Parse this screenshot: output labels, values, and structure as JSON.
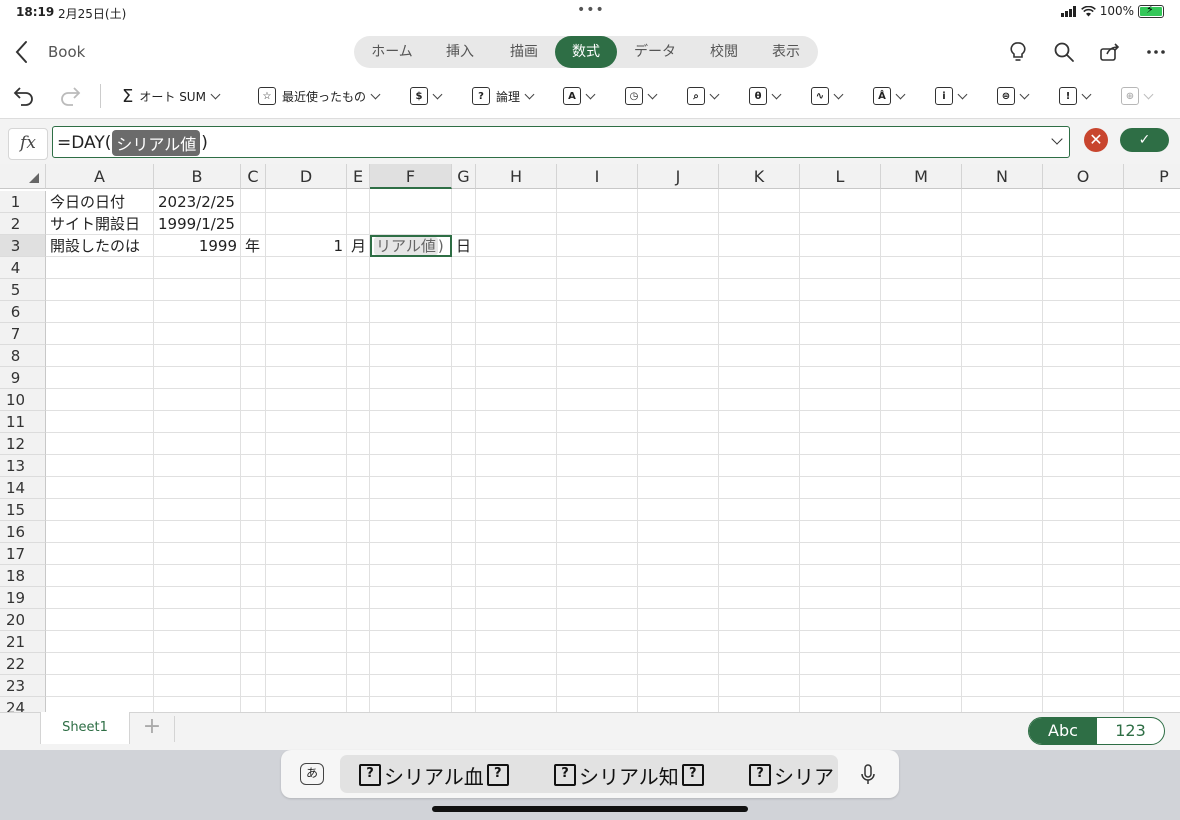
{
  "status": {
    "time": "18:19",
    "date": "2月25日(土)",
    "battery": "100%"
  },
  "header": {
    "book_title": "Book"
  },
  "tabs": [
    {
      "label": "ホーム"
    },
    {
      "label": "挿入"
    },
    {
      "label": "描画"
    },
    {
      "label": "数式"
    },
    {
      "label": "データ"
    },
    {
      "label": "校閲"
    },
    {
      "label": "表示"
    }
  ],
  "active_tab": "数式",
  "ribbon": {
    "autosum_label": "オート SUM",
    "recent_label": "最近使ったもの",
    "logical_label": "論理",
    "autosum_symbol": "Σ"
  },
  "formula": {
    "fx_label": "fx",
    "prefix": "=DAY(",
    "arg_chip": "シリアル値",
    "suffix": ")",
    "cancel_symbol": "✕",
    "enter_symbol": "✓"
  },
  "grid": {
    "columns": [
      "A",
      "B",
      "C",
      "D",
      "E",
      "F",
      "G",
      "H",
      "I",
      "J",
      "K",
      "L",
      "M",
      "N",
      "O",
      "P"
    ],
    "rows": [
      "1",
      "2",
      "3",
      "4",
      "5",
      "6",
      "7",
      "8",
      "9",
      "10",
      "11",
      "12",
      "13",
      "14",
      "15",
      "16",
      "17",
      "18",
      "19",
      "20",
      "21",
      "22",
      "23",
      "24"
    ],
    "cells": {
      "A1": "今日の日付",
      "B1": "2023/2/25",
      "A2": "サイト開設日",
      "B2": "1999/1/25",
      "A3": "開設したのは",
      "B3": "1999",
      "C3": "年",
      "D3": "1",
      "E3": "月",
      "G3": "日"
    },
    "active_cell_text": "リアル値",
    "active_cell_suffix": ")",
    "selected_column": "F",
    "selected_row": "3"
  },
  "sheets": {
    "tabs": [
      "Sheet1"
    ],
    "add_symbol": "+"
  },
  "keyboard_toggle": {
    "abc": "Abc",
    "num": "123"
  },
  "suggestions": {
    "ime_label": "あ",
    "items": [
      {
        "text": "シリアル血"
      },
      {
        "text": "シリアル知"
      },
      {
        "text": "シリア"
      }
    ],
    "unknown_glyph": "?"
  }
}
